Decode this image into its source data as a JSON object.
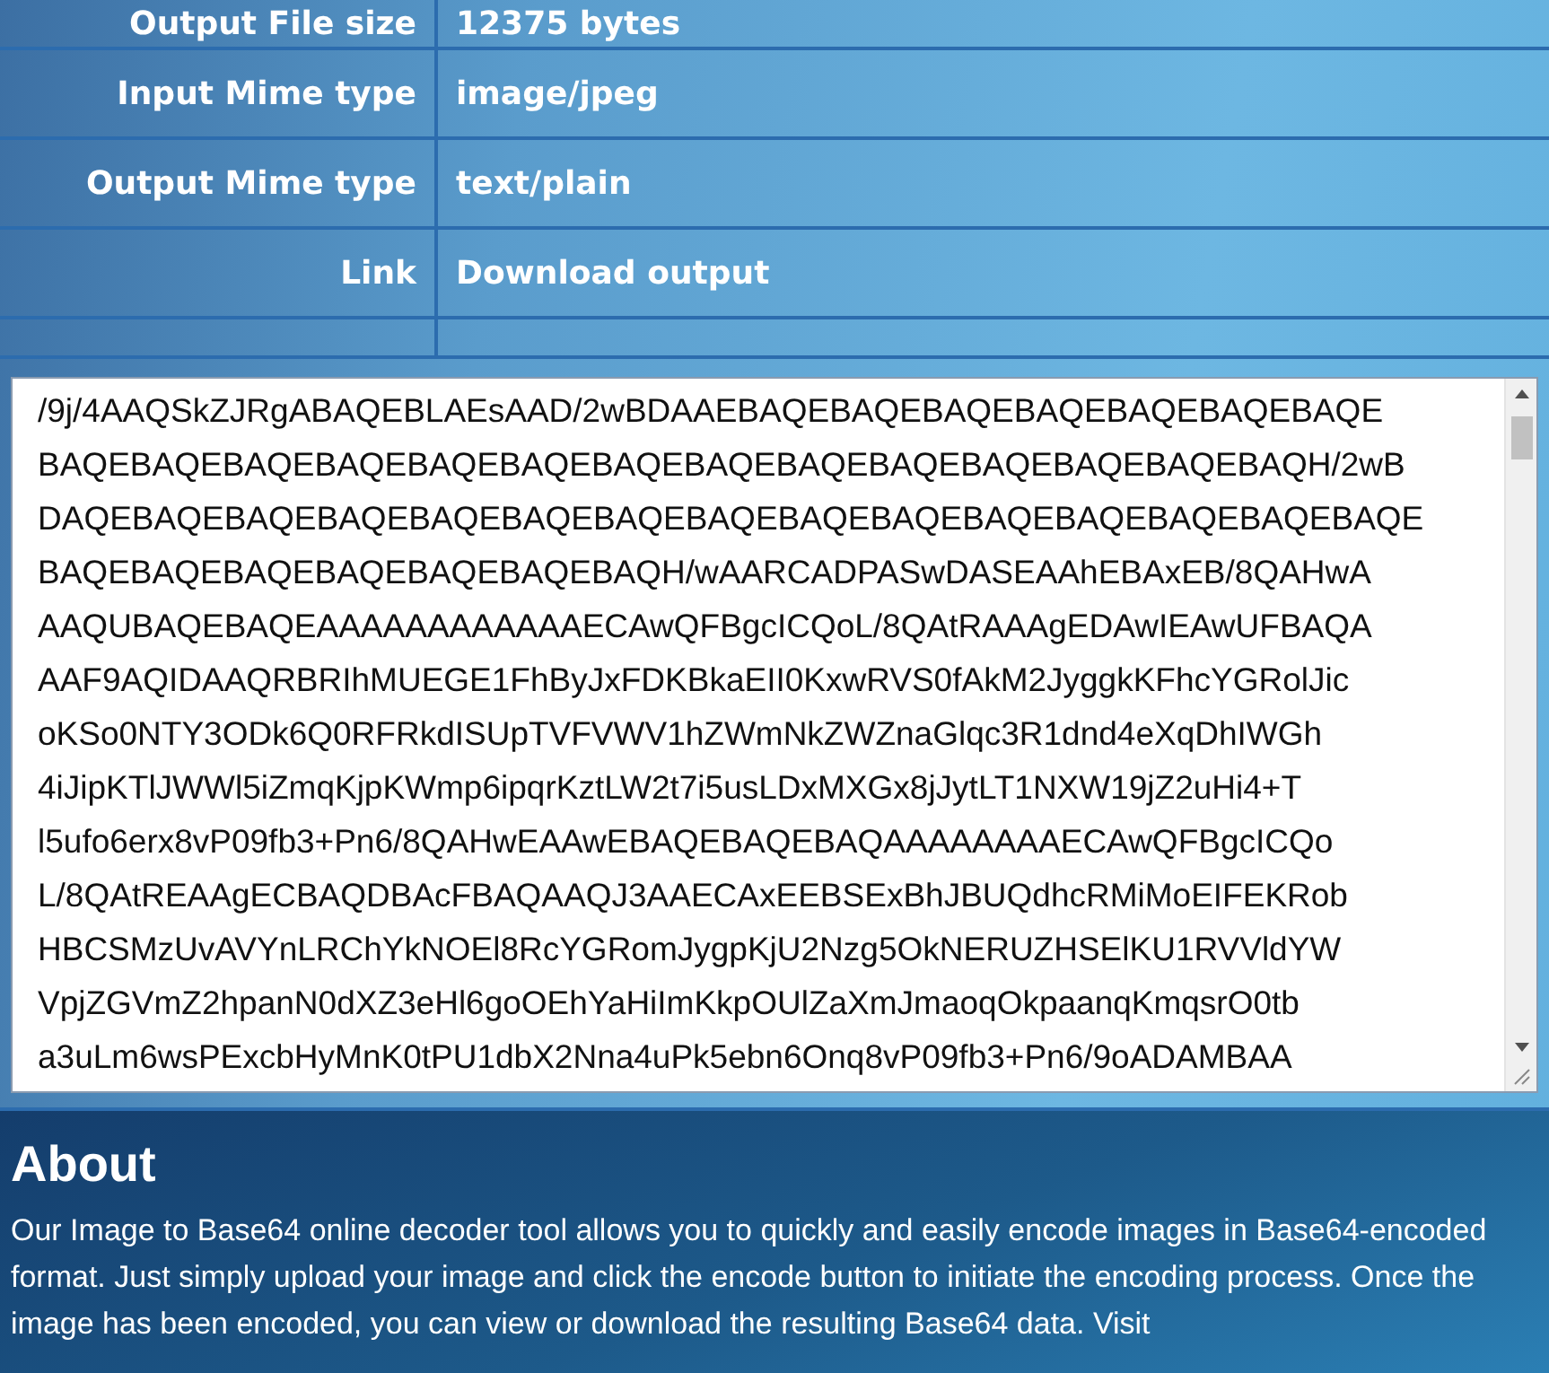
{
  "info_table": {
    "rows": [
      {
        "label": "Output File size",
        "value": "12375 bytes"
      },
      {
        "label": "Input Mime type",
        "value": "image/jpeg"
      },
      {
        "label": "Output Mime type",
        "value": "text/plain"
      },
      {
        "label": "Link",
        "value": "Download output"
      }
    ]
  },
  "output": {
    "lines": [
      "/9j/4AAQSkZJRgABAQEBLAEsAAD/2wBDAAEBAQEBAQEBAQEBAQEBAQEBAQEBAQE",
      "BAQEBAQEBAQEBAQEBAQEBAQEBAQEBAQEBAQEBAQEBAQEBAQEBAQEBAQH/2wB",
      "DAQEBAQEBAQEBAQEBAQEBAQEBAQEBAQEBAQEBAQEBAQEBAQEBAQEBAQEBAQE",
      "BAQEBAQEBAQEBAQEBAQEBAQEBAQH/wAARCADPASwDASEAAhEBAxEB/8QAHwA",
      "AAQUBAQEBAQEAAAAAAAAAAAAECAwQFBgcICQoL/8QAtRAAAgEDAwIEAwUFBAQA",
      "AAF9AQIDAAQRBRIhMUEGE1FhByJxFDKBkaEII0KxwRVS0fAkM2JyggkKFhcYGRolJic",
      "oKSo0NTY3ODk6Q0RFRkdISUpTVFVWV1hZWmNkZWZnaGlqc3R1dnd4eXqDhIWGh",
      "4iJipKTlJWWl5iZmqKjpKWmp6ipqrKztLW2t7i5usLDxMXGx8jJytLT1NXW19jZ2uHi4+T",
      "l5ufo6erx8vP09fb3+Pn6/8QAHwEAAwEBAQEBAQEBAQAAAAAAAAECAwQFBgcICQo",
      "L/8QAtREAAgECBAQDBAcFBAQAAQJ3AAECAxEEBSExBhJBUQdhcRMiMoEIFEKRob",
      "HBCSMzUvAVYnLRChYkNOEl8RcYGRomJygpKjU2Nzg5OkNERUZHSElKU1RVVldYW",
      "VpjZGVmZ2hpanN0dXZ3eHl6goOEhYaHiImKkpOUlZaXmJmaoqOkpaanqKmqsrO0tb",
      "a3uLm6wsPExcbHyMnK0tPU1dbX2Nna4uPk5ebn6Onq8vP09fb3+Pn6/9oADAMBAA"
    ]
  },
  "about": {
    "title": "About",
    "text": "Our Image to Base64 online decoder tool allows you to quickly and easily encode images in Base64-encoded format. Just simply upload your image and click the encode button to initiate the encoding process. Once the image has been encoded, you can view or download the resulting Base64 data. Visit"
  }
}
